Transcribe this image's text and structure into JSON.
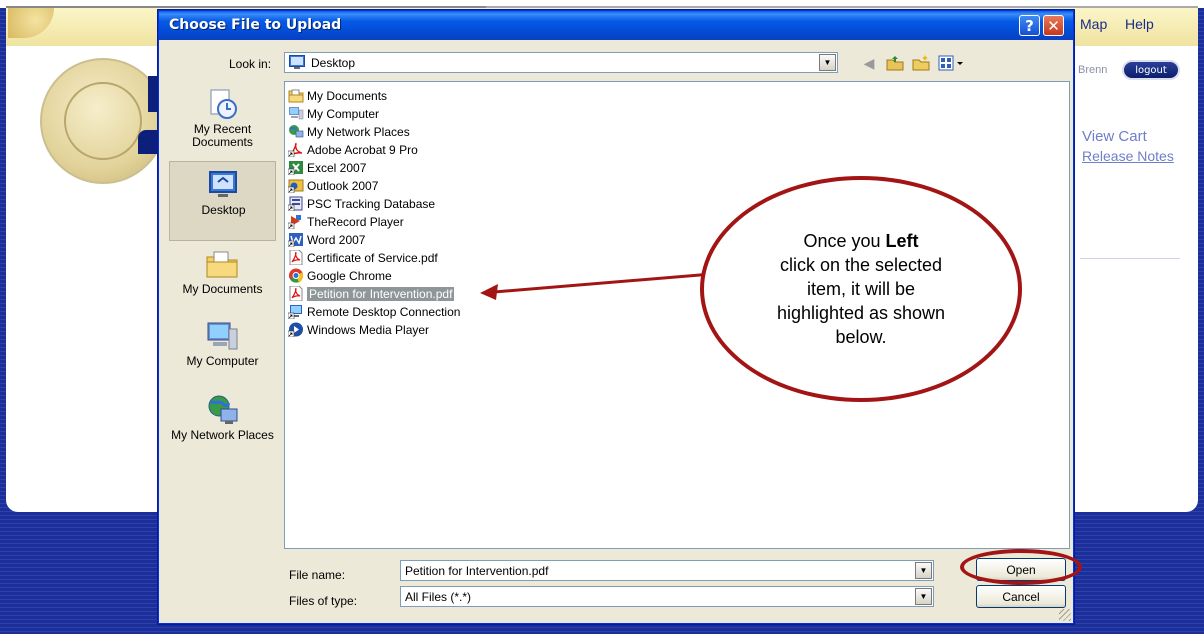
{
  "background_page": {
    "nav": {
      "map": "Map",
      "help": "Help"
    },
    "user_text": "Brenn",
    "logout_label": "logout",
    "view_cart": "View Cart",
    "release_notes": "Release Notes"
  },
  "dialog": {
    "title": "Choose File to Upload",
    "help_glyph": "?",
    "close_glyph": "✕",
    "look_in_label": "Look in:",
    "look_in_value": "Desktop",
    "toolbar": {
      "back_icon": "back-arrow-icon",
      "up_icon": "up-folder-icon",
      "new_folder_icon": "new-folder-icon",
      "views_icon": "views-menu-icon"
    },
    "places": [
      {
        "label": "My Recent Documents",
        "icon": "recent-documents-icon"
      },
      {
        "label": "Desktop",
        "icon": "desktop-icon",
        "selected": true
      },
      {
        "label": "My Documents",
        "icon": "my-documents-icon"
      },
      {
        "label": "My Computer",
        "icon": "my-computer-icon"
      },
      {
        "label": "My Network Places",
        "icon": "network-places-icon"
      }
    ],
    "files": [
      {
        "name": "My Documents",
        "icon": "folder-icon"
      },
      {
        "name": "My Computer",
        "icon": "computer-icon"
      },
      {
        "name": "My Network Places",
        "icon": "network-icon"
      },
      {
        "name": "Adobe Acrobat 9 Pro",
        "icon": "acrobat-shortcut-icon"
      },
      {
        "name": "Excel 2007",
        "icon": "excel-shortcut-icon"
      },
      {
        "name": "Outlook 2007",
        "icon": "outlook-shortcut-icon"
      },
      {
        "name": "PSC Tracking Database",
        "icon": "database-shortcut-icon"
      },
      {
        "name": "TheRecord Player",
        "icon": "player-shortcut-icon"
      },
      {
        "name": "Word 2007",
        "icon": "word-shortcut-icon"
      },
      {
        "name": "Certificate of Service.pdf",
        "icon": "pdf-icon"
      },
      {
        "name": "Google Chrome",
        "icon": "chrome-shortcut-icon"
      },
      {
        "name": "Petition for Intervention.pdf",
        "icon": "pdf-icon",
        "selected": true
      },
      {
        "name": "Remote Desktop Connection",
        "icon": "remote-desktop-shortcut-icon"
      },
      {
        "name": "Windows Media Player",
        "icon": "media-player-shortcut-icon"
      }
    ],
    "file_name_label": "File name:",
    "file_name_value": "Petition for Intervention.pdf",
    "file_type_label": "Files of type:",
    "file_type_value": "All Files (*.*)",
    "open_label": "Open",
    "cancel_label": "Cancel"
  },
  "annotation": {
    "line1_pre": "Once you ",
    "line1_bold": "Left",
    "rest": "click on the selected item, it will be highlighted as shown below.",
    "color": "#a31515"
  }
}
